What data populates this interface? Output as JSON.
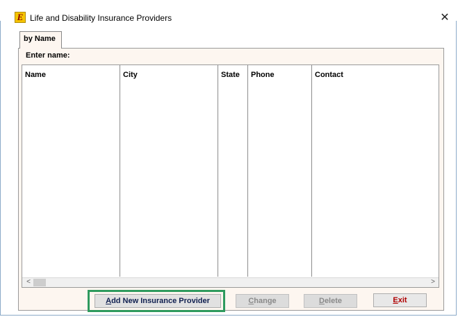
{
  "window": {
    "title": "Life and Disability Insurance Providers",
    "app_icon_letter": "E",
    "close_glyph": "✕"
  },
  "tabs": [
    {
      "label": "by Name",
      "active": true
    }
  ],
  "search": {
    "label": "Enter name:"
  },
  "table": {
    "columns": [
      "Name",
      "City",
      "State",
      "Phone",
      "Contact"
    ],
    "rows": []
  },
  "scrollbar": {
    "left_arrow": "<",
    "right_arrow": ">"
  },
  "buttons": {
    "add": {
      "accel": "A",
      "rest": "dd New Insurance Provider"
    },
    "change": {
      "accel": "C",
      "rest": "hange"
    },
    "delete": {
      "accel": "D",
      "rest": "elete"
    },
    "exit": {
      "accel": "E",
      "rest": "xit"
    }
  },
  "colors": {
    "highlight": "#2e9a5e",
    "exit_text": "#b00000",
    "panel_bg": "#fdf6f0"
  }
}
